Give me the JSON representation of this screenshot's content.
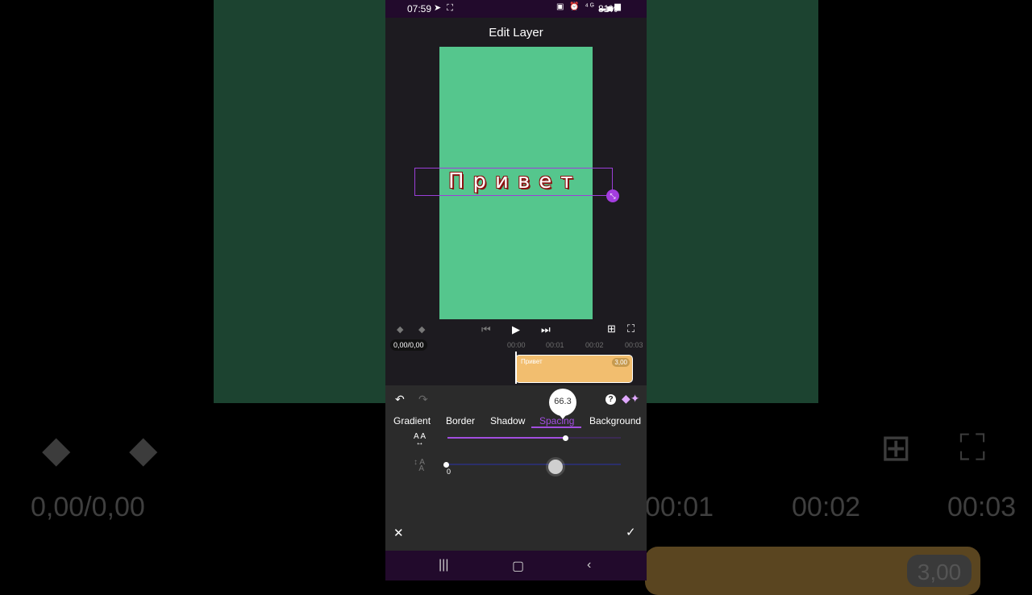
{
  "background": {
    "time_display": "0,00/0,00",
    "ruler_left": "00:01",
    "ruler_mid": "00:02",
    "ruler_right": "00:03",
    "clip_duration": "3,00"
  },
  "status_bar": {
    "time": "07:59",
    "battery": "81%"
  },
  "screen": {
    "title": "Edit Layer"
  },
  "preview": {
    "canvas_color": "#55c68d",
    "overlay_text": "Привет"
  },
  "playback": {
    "time_display": "0,00/0,00"
  },
  "timeline": {
    "ticks": [
      "00:00",
      "00:01",
      "00:02",
      "00:03"
    ],
    "clip_label": "Привет",
    "clip_duration": "3,00",
    "clip_color": "#f2be6f"
  },
  "panel": {
    "tabs": [
      "Gradient",
      "Border",
      "Shadow",
      "Spacing",
      "Background"
    ],
    "active_tab": "Spacing",
    "accent": "#a24ee0",
    "letter_spacing": {
      "bubble_value": "66.3",
      "level": 0.68
    },
    "line_spacing": {
      "value_label": "0",
      "level": 0.0
    }
  }
}
